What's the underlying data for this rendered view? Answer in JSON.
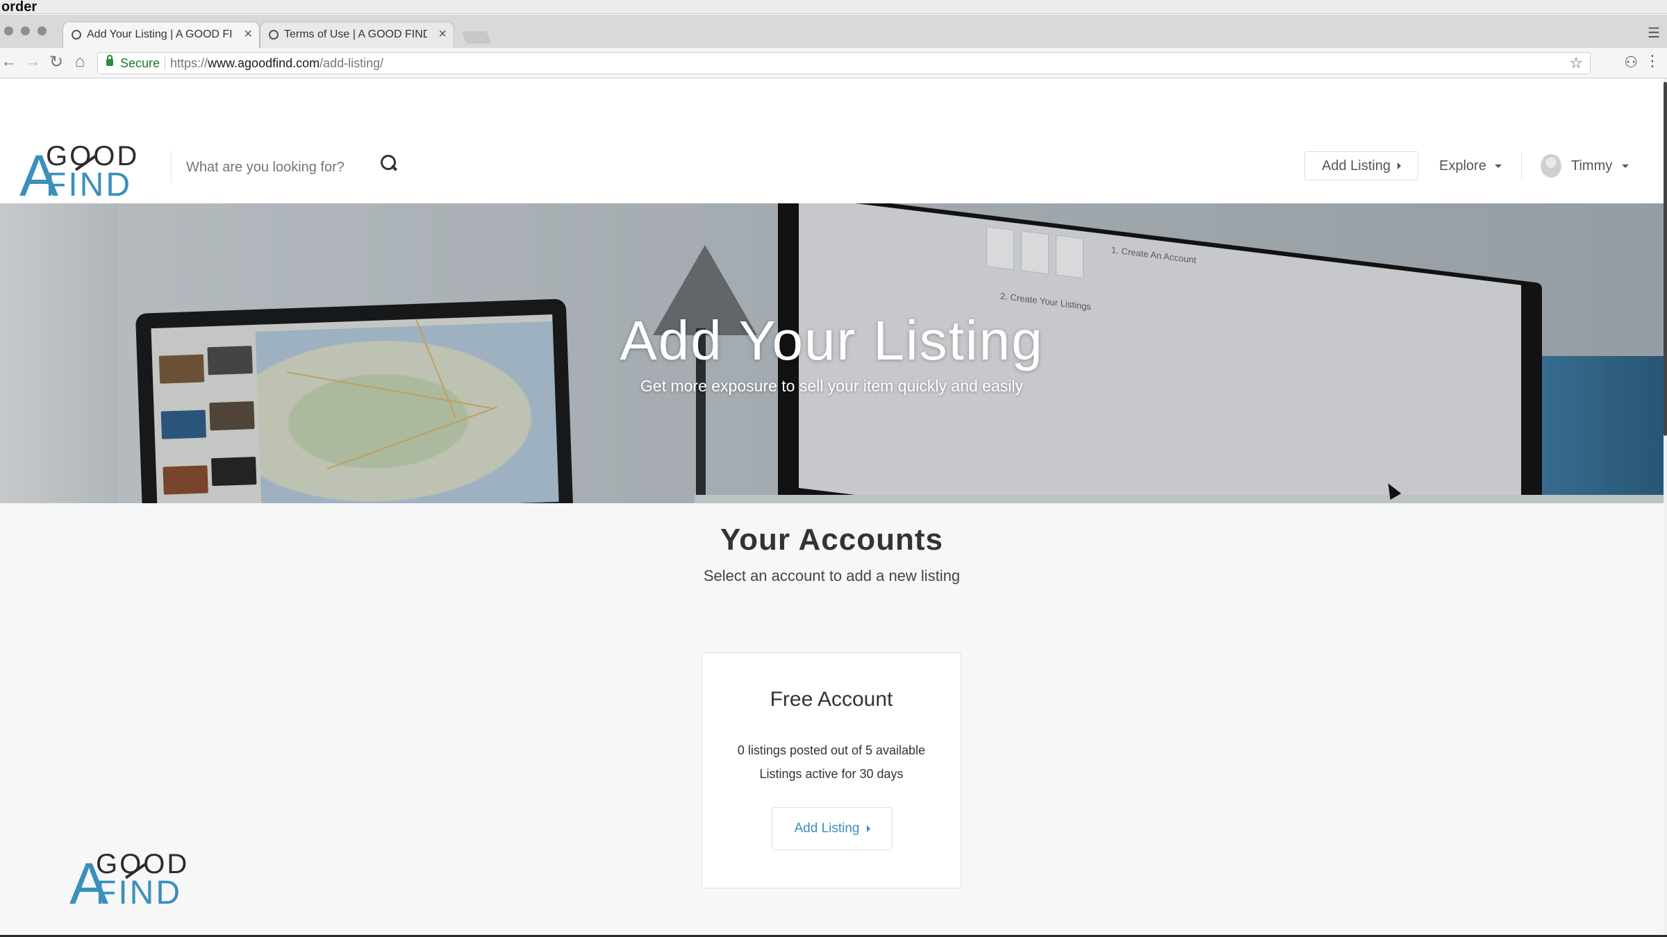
{
  "os": {
    "title": "order"
  },
  "browser": {
    "tabs": [
      {
        "title": "Add Your Listing | A GOOD FIND",
        "active": true
      },
      {
        "title": "Terms of Use | A GOOD FIND",
        "active": false
      }
    ],
    "close_glyph": "×",
    "secure_label": "Secure",
    "url_scheme": "https://",
    "url_host": "www.agoodfind.com",
    "url_path": "/add-listing/"
  },
  "logo": {
    "letter": "A",
    "top": "GOOD",
    "bottom": "FIND"
  },
  "header": {
    "search_placeholder": "What are you looking for?",
    "add_listing_label": "Add Listing",
    "explore_label": "Explore",
    "user_name": "Timmy"
  },
  "hero": {
    "title": "Add Your Listing",
    "subtitle": "Get more exposure to sell your item quickly and easily",
    "screen_heading_1": "1. Create An Account",
    "screen_heading_2": "2. Create Your Listings"
  },
  "accounts": {
    "title": "Your Accounts",
    "subtitle": "Select an account to add a new listing",
    "cards": [
      {
        "name": "Free Account",
        "line1": "0 listings posted out of 5 available",
        "line2": "Listings active for 30 days",
        "button_label": "Add Listing"
      }
    ]
  },
  "colors": {
    "brand_blue": "#3a8fbd",
    "secure_green": "#1b7a2c",
    "text_dark": "#333333"
  }
}
